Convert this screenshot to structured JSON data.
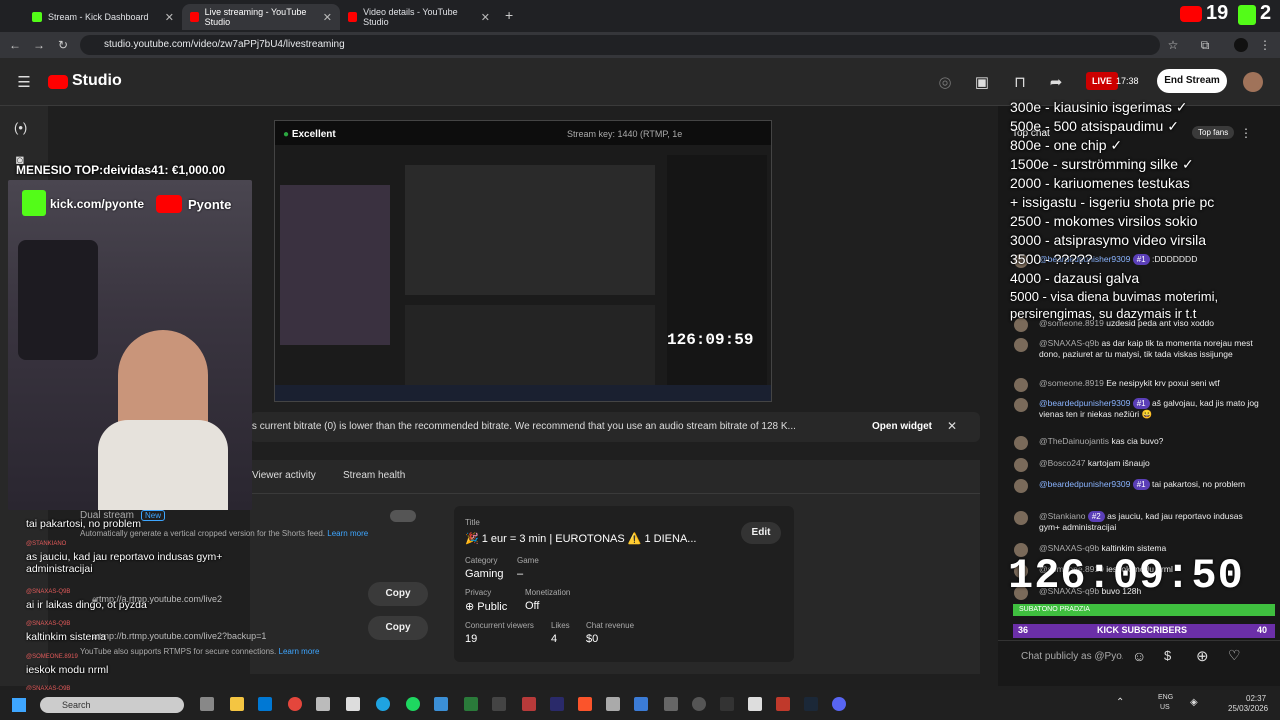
{
  "tabs": [
    {
      "label": "Stream - Kick Dashboard",
      "color": "#53fc18"
    },
    {
      "label": "Live streaming - YouTube Studio",
      "color": "#ff0000"
    },
    {
      "label": "Video details - YouTube Studio",
      "color": "#ff0000"
    }
  ],
  "address": {
    "url": "studio.youtube.com/video/zw7aPPj7bU4/livestreaming"
  },
  "header": {
    "logo": "Studio",
    "live_label": "LIVE",
    "live_time": "17:38",
    "end_stream": "End Stream"
  },
  "preview": {
    "status": "Excellent",
    "stream_key": "Stream key: 1440 (RTMP, 1e"
  },
  "warning": {
    "text": "'s current bitrate (0) is lower than the recommended bitrate. We recommend that you use an audio stream bitrate of 128 K...",
    "button": "Open widget"
  },
  "tabs_main": {
    "viewer_activity": "Viewer activity",
    "stream_health": "Stream health"
  },
  "settings": {
    "dual_stream": "Dual stream",
    "new_badge": "New",
    "auto_text": "Automatically generate a vertical cropped version for the Shorts feed.",
    "learn_more": "Learn more",
    "url1": "rtmp://a.rtmp.youtube.com/live2",
    "url2": "rtmp://b.rtmp.youtube.com/live2?backup=1",
    "copy": "Copy",
    "rtmps_text": "YouTube also supports RTMPS for secure connections."
  },
  "details": {
    "title_label": "Title",
    "title_value": "🎉 1 eur = 3 min | EUROTONAS ⚠️ 1 DIENA...",
    "edit": "Edit",
    "category_label": "Category",
    "category_value": "Gaming",
    "game_label": "Game",
    "game_value": "–",
    "privacy_label": "Privacy",
    "privacy_value": "Public",
    "monetization_label": "Monetization",
    "monetization_value": "Off",
    "viewers_label": "Concurrent viewers",
    "viewers_value": "19",
    "likes_label": "Likes",
    "likes_value": "4",
    "revenue_label": "Chat revenue",
    "revenue_value": "$0"
  },
  "chat": {
    "top_chat": "Top chat",
    "top_fans": "Top fans",
    "messages": [
      {
        "user": "@beardedpunisher9309",
        "badge": "#1",
        "text": ":DDDDDDD",
        "blue": true
      },
      {
        "user": "@someone.8919",
        "text": "uzdesid peda ant viso xoddo",
        "blue": false
      },
      {
        "user": "@SNAXAS-q9b",
        "text": "as dar kaip tik ta momenta norejau mest dono, paziuret ar tu matysi, tik tada viskas issijunge",
        "blue": false
      },
      {
        "user": "@someone.8919",
        "text": "Ee nesipykit krv poxui seni wtf",
        "blue": false
      },
      {
        "user": "@beardedpunisher9309",
        "badge": "#1",
        "text": "aš galvojau, kad jis mato jog vienas ten ir niekas nežiūri 😀",
        "blue": true
      },
      {
        "user": "@TheDainuojantis",
        "text": "kas cia buvo?",
        "blue": false
      },
      {
        "user": "@Bosco247",
        "text": "kartojam išnaujo",
        "blue": false
      },
      {
        "user": "@beardedpunisher9309",
        "badge": "#1",
        "text": "tai pakartosi, no problem",
        "blue": true
      },
      {
        "user": "@Stankiano",
        "badge": "#2",
        "text": "as jauciu, kad jau reportavo indusas gym+ administracijai",
        "blue": false
      },
      {
        "user": "@SNAXAS-q9b",
        "text": "kaltinkim sistema",
        "blue": false
      },
      {
        "user": "@someone.8919",
        "text": "ieskok modu nrml",
        "blue": false
      },
      {
        "user": "@SNAXAS-q9b",
        "text": "buvo 128h",
        "blue": false
      }
    ],
    "input_placeholder": "Chat publicly as @Pyo..."
  },
  "overlay": {
    "top_text": "MENESIO TOP:deividas41: €1,000.00",
    "kick_url": "kick.com/pyonte",
    "yt_name": "Pyonte",
    "list": [
      "300e - kiausinio isgerimas ✓",
      "500e - 500 atsispaudimu ✓",
      "800e - one chip ✓",
      "1500e - surströmming silke ✓",
      "2000 - kariuomenes testukas",
      "+ issigastu - isgeriu shota prie pc",
      "2500 - mokomes virsilos sokio",
      "3000 - atsiprasymo video virsila",
      "3500 - ?????",
      "4000 - dazausi galva",
      "5000 - visa diena buvimas moterimi, persirengimas, su dazymais ir t.t"
    ],
    "timer": "126:09:50",
    "subathon": "SUBATONO PRADZIA",
    "kick_subs_count": "36",
    "kick_subs_label": "KICK SUBSCRIBERS",
    "kick_subs_goal": "40",
    "top_numbers": "19",
    "chat_lines": [
      {
        "name": "",
        "text": "tai pakartosi, no problem"
      },
      {
        "name": "@STANKIANO",
        "text": "as jauciu, kad jau reportavo indusas gym+ administracijai"
      },
      {
        "name": "@SNAXAS-Q9B",
        "text": "ai ir laikas dingo, ot pyzda"
      },
      {
        "name": "@SNAXAS-Q9B",
        "text": "kaltinkim sistema"
      },
      {
        "name": "@SOMEONE.8919",
        "text": "ieskok modu nrml"
      },
      {
        "name": "@SNAXAS-Q9B",
        "text": "buvo 128h"
      }
    ]
  },
  "taskbar": {
    "search": "Search",
    "lang1": "ENG",
    "lang2": "US",
    "time": "02:37",
    "date": "25/03/2026"
  }
}
